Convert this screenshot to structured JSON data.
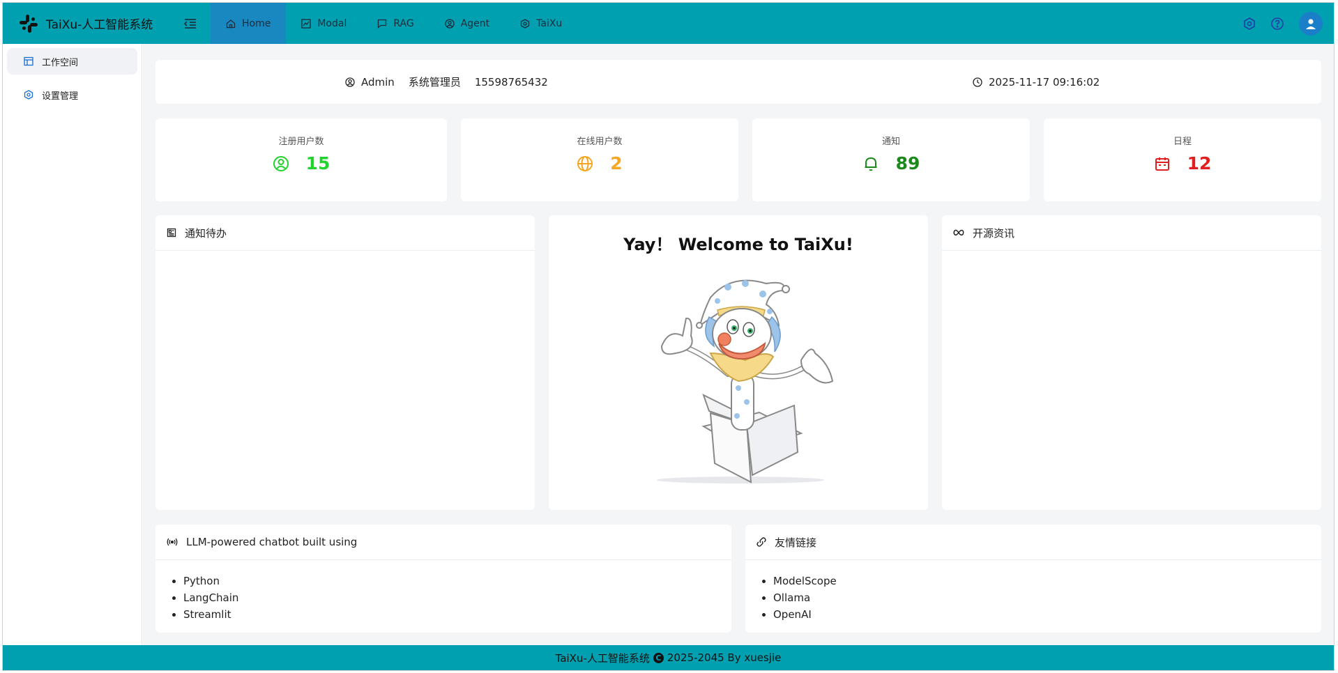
{
  "header": {
    "app_title": "TaiXu-人工智能系统",
    "nav": [
      {
        "label": "Home"
      },
      {
        "label": "Modal"
      },
      {
        "label": "RAG"
      },
      {
        "label": "Agent"
      },
      {
        "label": "TaiXu"
      }
    ],
    "icons": {
      "logo": "slack-logo-icon",
      "collapse": "menu-fold-icon",
      "settings": "settings-hex-icon",
      "help": "help-circle-icon",
      "avatar": "user-icon"
    }
  },
  "sidebar": {
    "items": [
      {
        "label": "工作空间",
        "icon": "layout-icon"
      },
      {
        "label": "设置管理",
        "icon": "settings-hex-icon"
      }
    ]
  },
  "info": {
    "username": "Admin",
    "role": "系统管理员",
    "phone": "15598765432",
    "datetime": "2025-11-17 09:16:02"
  },
  "stats": [
    {
      "label": "注册用户数",
      "value": "15",
      "color": "#22d32e",
      "icon": "user-circle-icon"
    },
    {
      "label": "在线用户数",
      "value": "2",
      "color": "#f5a623",
      "icon": "globe-icon"
    },
    {
      "label": "通知",
      "value": "89",
      "color": "#1a8a1a",
      "icon": "bell-icon"
    },
    {
      "label": "日程",
      "value": "12",
      "color": "#e02020",
      "icon": "calendar-icon"
    }
  ],
  "panels": {
    "todo_title": "通知待办",
    "welcome_title": "Yay！ Welcome to TaiXu!",
    "news_title": "开源资讯",
    "built_title": "LLM-powered chatbot built using",
    "built_items": [
      "Python",
      "LangChain",
      "Streamlit"
    ],
    "links_title": "友情链接",
    "links_items": [
      "ModelScope",
      "Ollama",
      "OpenAI"
    ]
  },
  "footer": {
    "left": "TaiXu-人工智能系统",
    "right": "2025-2045 By xuesjie"
  },
  "colors": {
    "header_bg": "#00a0b0",
    "nav_active": "#1a88c0",
    "footer_bg": "#00a0b0"
  }
}
